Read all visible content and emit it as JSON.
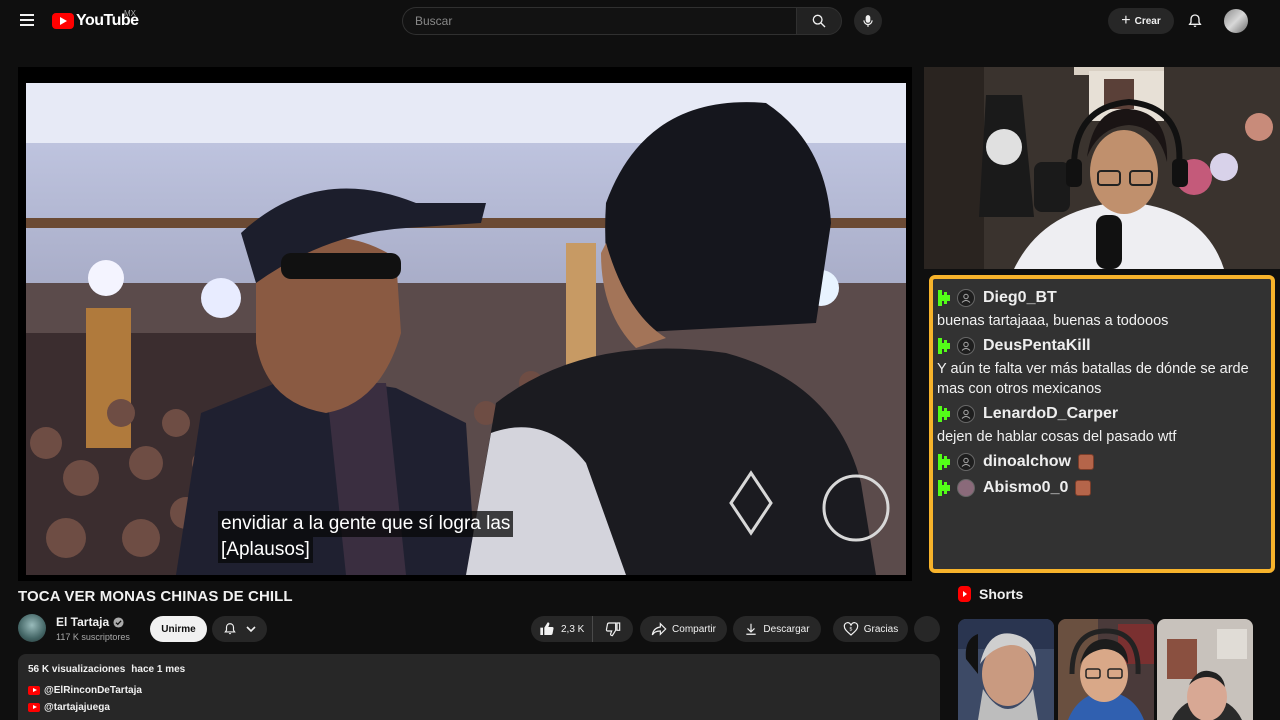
{
  "header": {
    "logo_text": "YouTube",
    "country_code": "MX",
    "search_placeholder": "Buscar",
    "create_label": "Crear"
  },
  "player": {
    "caption_lines": [
      "envidiar a la gente que sí logra las",
      "[Aplausos]"
    ]
  },
  "chat": {
    "messages": [
      {
        "user": "Dieg0_BT",
        "text": "buenas tartajaaa, buenas a todooos",
        "emote": false
      },
      {
        "user": "DeusPentaKill",
        "text": "Y aún te falta ver más batallas de dónde se arde mas con otros mexicanos",
        "emote": false
      },
      {
        "user": "LenardoD_Carper",
        "text": "dejen de hablar cosas del pasado wtf",
        "emote": false
      },
      {
        "user": "dinoalchow",
        "text": "",
        "emote": true
      },
      {
        "user": "Abismo0_0",
        "text": "",
        "emote": true
      }
    ]
  },
  "video": {
    "title": "TOCA VER MONAS CHINAS DE CHILL",
    "channel_name": "El Tartaja",
    "subscribers": "117 K suscriptores",
    "join_label": "Unirme",
    "likes": "2,3 K",
    "share_label": "Compartir",
    "download_label": "Descargar",
    "thanks_label": "Gracias"
  },
  "description": {
    "views": "56 K visualizaciones",
    "date": "hace 1 mes",
    "links": [
      "@ElRinconDeTartaja",
      "@tartajajuega"
    ]
  },
  "shorts": {
    "title": "Shorts"
  },
  "colors": {
    "background": "#0f0f0f",
    "chat_border": "#f7b32b",
    "kick_green": "#53fc18",
    "youtube_red": "#ff0000"
  }
}
